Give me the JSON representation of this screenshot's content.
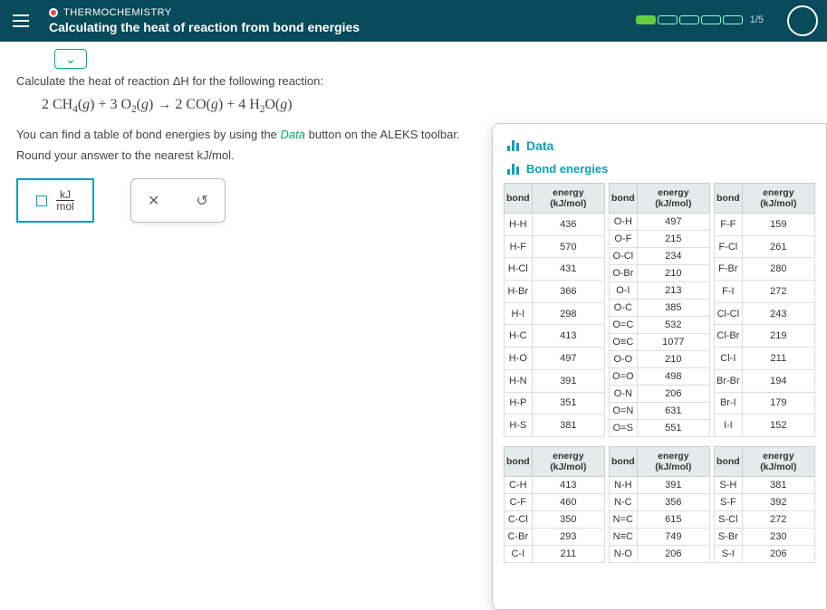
{
  "header": {
    "topic": "THERMOCHEMISTRY",
    "title": "Calculating the heat of reaction from bond energies",
    "progress_label": "1/5"
  },
  "question": {
    "line1": "Calculate the heat of reaction ΔH for the following reaction:",
    "equation_html": "2 CH<sub>4</sub>(<i>g</i>) + 3 O<sub>2</sub>(<i>g</i>) → 2 CO(<i>g</i>) + 4 H<sub>2</sub>O(<i>g</i>)",
    "line2_a": "You can find a table of bond energies by using the ",
    "line2_b": "Data",
    "line2_c": " button on the ALEKS toolbar.",
    "line3": "Round your answer to the nearest kJ/mol.",
    "unit_top": "kJ",
    "unit_bot": "mol"
  },
  "tool": {
    "clear": "✕",
    "reset": "↺"
  },
  "panel": {
    "title": "Data",
    "subtitle": "Bond energies",
    "col_h1": "bond",
    "col_h2": "energy (kJ/mol)"
  },
  "bonds_top": [
    [
      {
        "b": "H-H",
        "e": 436
      },
      {
        "b": "H-F",
        "e": 570
      },
      {
        "b": "H-Cl",
        "e": 431
      },
      {
        "b": "H-Br",
        "e": 366
      },
      {
        "b": "H-I",
        "e": 298
      },
      {
        "b": "H-C",
        "e": 413
      },
      {
        "b": "H-O",
        "e": 497
      },
      {
        "b": "H-N",
        "e": 391
      },
      {
        "b": "H-P",
        "e": 351
      },
      {
        "b": "H-S",
        "e": 381
      }
    ],
    [
      {
        "b": "O-H",
        "e": 497
      },
      {
        "b": "O-F",
        "e": 215
      },
      {
        "b": "O-Cl",
        "e": 234
      },
      {
        "b": "O-Br",
        "e": 210
      },
      {
        "b": "O-I",
        "e": 213
      },
      {
        "b": "O-C",
        "e": 385
      },
      {
        "b": "O=C",
        "e": 532
      },
      {
        "b": "O≡C",
        "e": 1077
      },
      {
        "b": "O-O",
        "e": 210
      },
      {
        "b": "O=O",
        "e": 498
      },
      {
        "b": "O-N",
        "e": 206
      },
      {
        "b": "O=N",
        "e": 631
      },
      {
        "b": "O=S",
        "e": 551
      }
    ],
    [
      {
        "b": "F-F",
        "e": 159
      },
      {
        "b": "F-Cl",
        "e": 261
      },
      {
        "b": "F-Br",
        "e": 280
      },
      {
        "b": "F-I",
        "e": 272
      },
      {
        "b": "Cl-Cl",
        "e": 243
      },
      {
        "b": "Cl-Br",
        "e": 219
      },
      {
        "b": "Cl-I",
        "e": 211
      },
      {
        "b": "Br-Br",
        "e": 194
      },
      {
        "b": "Br-I",
        "e": 179
      },
      {
        "b": "I-I",
        "e": 152
      }
    ]
  ],
  "bonds_bot": [
    [
      {
        "b": "C-H",
        "e": 413
      },
      {
        "b": "C-F",
        "e": 460
      },
      {
        "b": "C-Cl",
        "e": 350
      },
      {
        "b": "C-Br",
        "e": 293
      },
      {
        "b": "C-I",
        "e": 211
      }
    ],
    [
      {
        "b": "N-H",
        "e": 391
      },
      {
        "b": "N-C",
        "e": 356
      },
      {
        "b": "N=C",
        "e": 615
      },
      {
        "b": "N≡C",
        "e": 749
      },
      {
        "b": "N-O",
        "e": 206
      }
    ],
    [
      {
        "b": "S-H",
        "e": 381
      },
      {
        "b": "S-F",
        "e": 392
      },
      {
        "b": "S-Cl",
        "e": 272
      },
      {
        "b": "S-Br",
        "e": 230
      },
      {
        "b": "S-I",
        "e": 206
      }
    ]
  ]
}
